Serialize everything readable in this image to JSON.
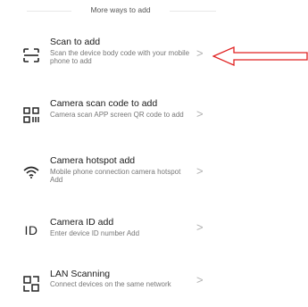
{
  "section": {
    "title": "More ways to add"
  },
  "items": [
    {
      "icon": "scan-frame-icon",
      "title": "Scan to add",
      "description": "Scan the device body code with your mobile phone to add"
    },
    {
      "icon": "qr-code-icon",
      "title": "Camera scan code to add",
      "description": "Camera scan APP screen QR code to add"
    },
    {
      "icon": "wifi-icon",
      "title": "Camera hotspot add",
      "description": "Mobile phone connection camera hotspot Add"
    },
    {
      "icon": "id-icon",
      "icon_text": "ID",
      "title": "Camera ID add",
      "description": "Enter device ID number Add"
    },
    {
      "icon": "lan-scan-icon",
      "title": "LAN Scanning",
      "description": "Connect devices on the same network"
    }
  ],
  "annotation": {
    "arrow_color": "#e02020"
  }
}
